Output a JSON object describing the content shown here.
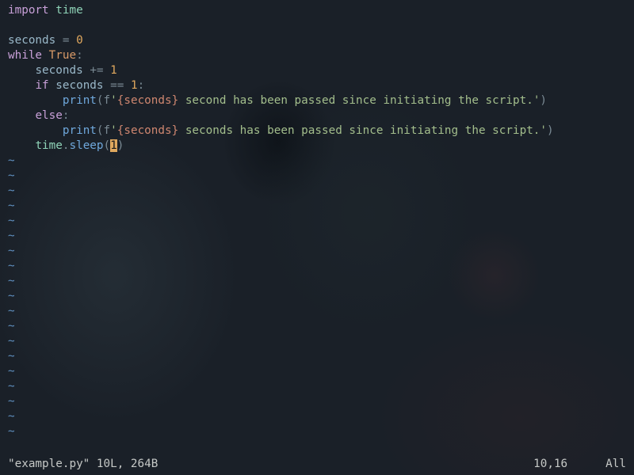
{
  "code": {
    "l1": {
      "kw": "import",
      "sp": " ",
      "mod": "time"
    },
    "l2": "",
    "l3": {
      "ident": "seconds",
      "sp1": " ",
      "op": "=",
      "sp2": " ",
      "num": "0"
    },
    "l4": {
      "kw": "while",
      "sp": " ",
      "bool": "True",
      "colon": ":"
    },
    "l5": {
      "indent": "    ",
      "ident": "seconds",
      "sp1": " ",
      "op": "+=",
      "sp2": " ",
      "num": "1"
    },
    "l6": {
      "indent": "    ",
      "kw": "if",
      "sp1": " ",
      "ident": "seconds",
      "sp2": " ",
      "op": "==",
      "sp3": " ",
      "num": "1",
      "colon": ":"
    },
    "l7": {
      "indent": "        ",
      "func": "print",
      "op1": "(",
      "fpre": "f",
      "q1": "'",
      "interp": "{seconds}",
      "str": " second has been passed since initiating the script.",
      "q2": "'",
      "op2": ")"
    },
    "l8": {
      "indent": "    ",
      "kw": "else",
      "colon": ":"
    },
    "l9": {
      "indent": "        ",
      "func": "print",
      "op1": "(",
      "fpre": "f",
      "q1": "'",
      "interp": "{seconds}",
      "str": " seconds has been passed since initiating the script.",
      "q2": "'",
      "op2": ")"
    },
    "l10": {
      "indent": "    ",
      "mod": "time",
      "dot": ".",
      "func": "sleep",
      "op1": "(",
      "num": "1",
      "op2": ")"
    }
  },
  "tilde": "~",
  "status": {
    "left": "\"example.py\" 10L, 264B",
    "pos": "10,16",
    "scroll": "All"
  }
}
